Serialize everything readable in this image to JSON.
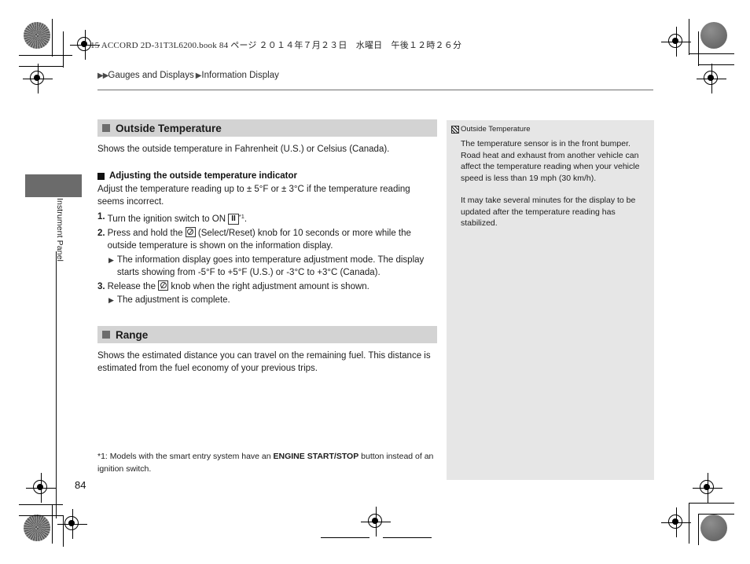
{
  "print_header": "15 ACCORD 2D-31T3L6200.book  84 ページ  ２０１４年７月２３日　水曜日　午後１２時２６分",
  "page_number": "84",
  "thumb_tab": {
    "label": "Instrument Panel"
  },
  "breadcrumb": {
    "lead_icon": "double-triangle-right-icon",
    "level1": "Gauges and Displays",
    "separator_icon": "triangle-right-icon",
    "level2": "Information Display"
  },
  "sections": [
    {
      "id": "outside-temperature",
      "heading": "Outside Temperature",
      "intro": "Shows the outside temperature in Fahrenheit (U.S.) or Celsius (Canada).",
      "subsection": {
        "heading": "Adjusting the outside temperature indicator",
        "intro": "Adjust the temperature reading up to ± 5°F or ± 3°C if the temperature reading seems incorrect.",
        "steps": [
          {
            "num": "1.",
            "text_before": "Turn the ignition switch to ON ",
            "key_glyph": "II",
            "footnote_ref": "*1",
            "text_after": "."
          },
          {
            "num": "2.",
            "text_before": "Press and hold the ",
            "knob_icon": "select-reset-knob-icon",
            "text_after": " (Select/Reset) knob for 10 seconds or more while the outside temperature is shown on the information display.",
            "bullets": [
              "The information display goes into temperature adjustment mode. The display starts showing from -5°F to +5°F (U.S.) or -3°C to +3°C (Canada)."
            ]
          },
          {
            "num": "3.",
            "text_before": "Release the ",
            "knob_icon": "select-reset-knob-icon",
            "text_after": " knob when the right adjustment amount is shown.",
            "bullets": [
              "The adjustment is complete."
            ]
          }
        ]
      }
    },
    {
      "id": "range",
      "heading": "Range",
      "intro": "Shows the estimated distance you can travel on the remaining fuel. This distance is estimated from the fuel economy of your previous trips."
    }
  ],
  "footnote": {
    "ref": "*1: ",
    "before_bold": "Models with the smart entry system have an ",
    "bold": "ENGINE START/STOP",
    "after_bold": " button instead of an ignition switch."
  },
  "sidenote": {
    "marker_icon": "note-marker-icon",
    "title": "Outside Temperature",
    "paragraphs": [
      "The temperature sensor is in the front bumper. Road heat and exhaust from another vehicle can affect the temperature reading when your vehicle speed is less than 19 mph (30 km/h).",
      "It may take several minutes for the display to be updated after the temperature reading has stabilized."
    ]
  },
  "colors": {
    "section_heading_bar": "#d3d3d3",
    "section_bullet": "#6d6d6d",
    "sidenote_background": "#e6e6e6",
    "thumb_tab": "#6b6b6b",
    "text": "#1d1d1d"
  }
}
